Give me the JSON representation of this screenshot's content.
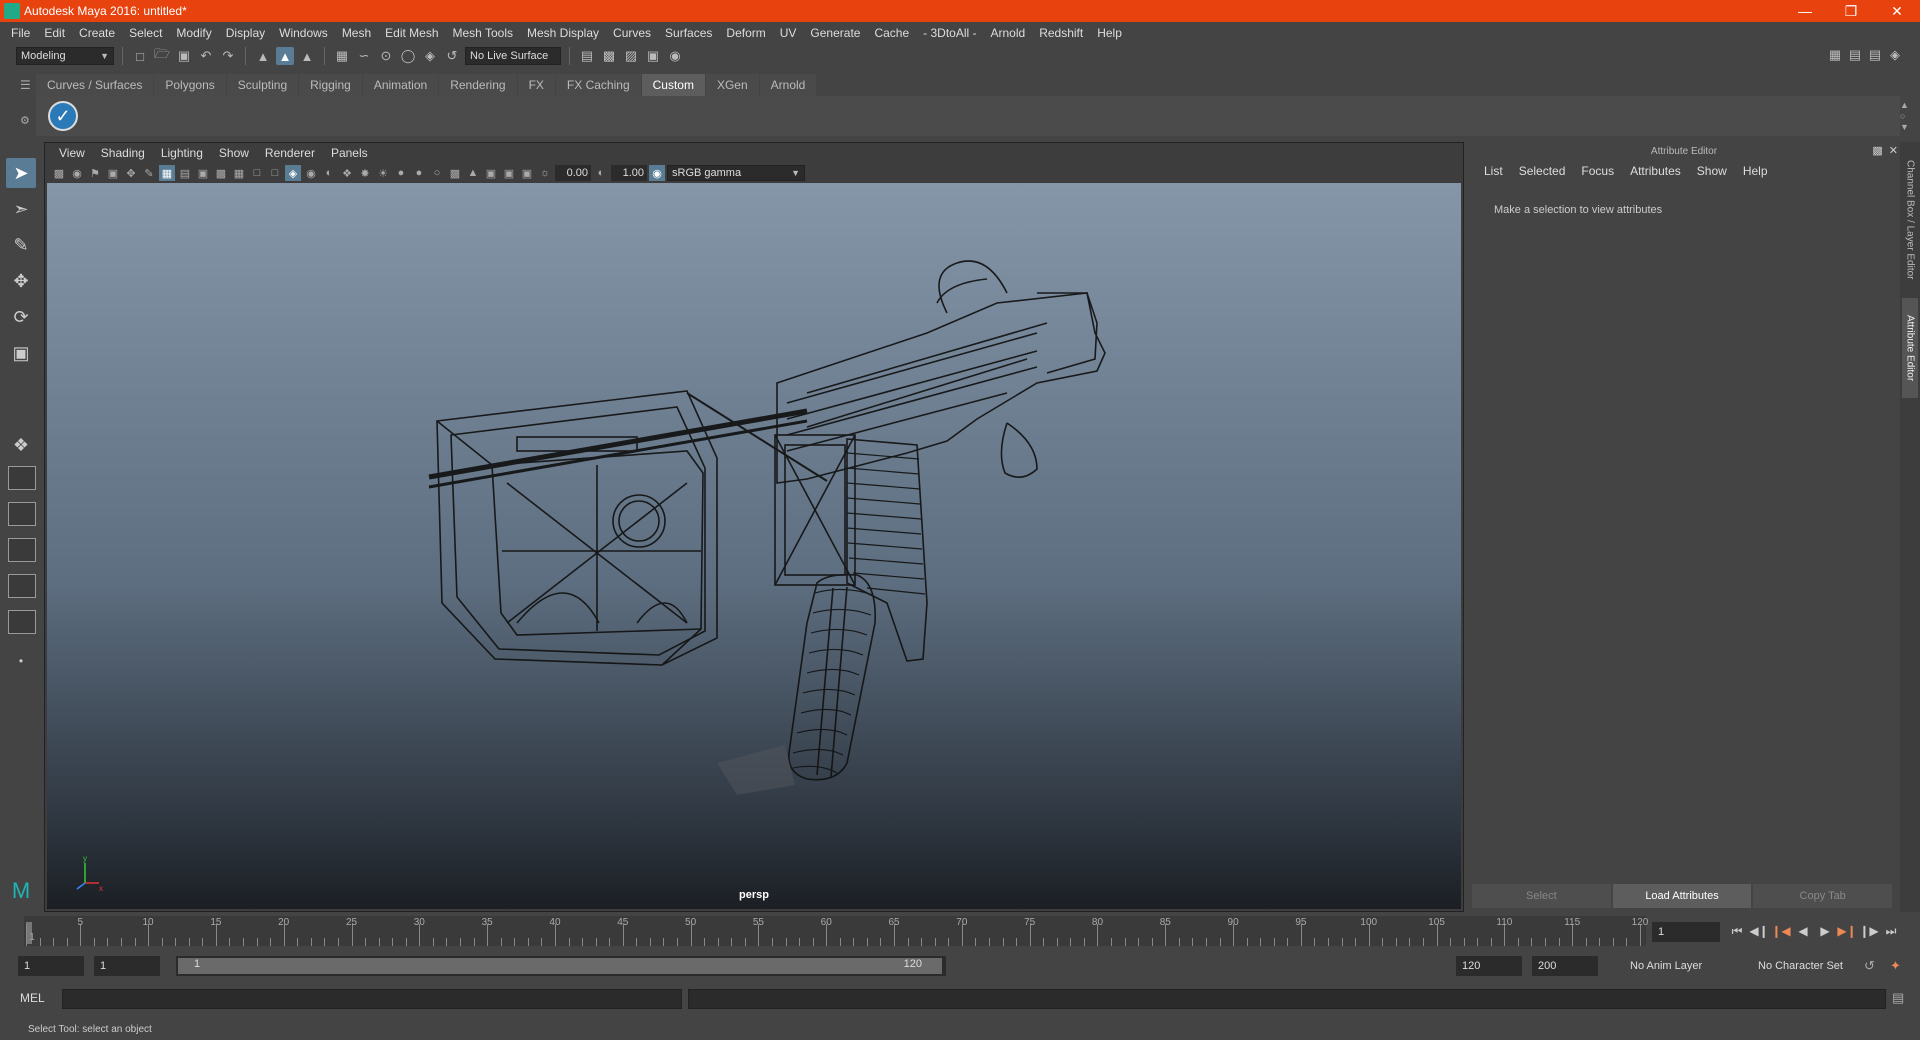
{
  "window": {
    "title": "Autodesk Maya 2016: untitled*"
  },
  "menubar": [
    "File",
    "Edit",
    "Create",
    "Select",
    "Modify",
    "Display",
    "Windows",
    "Mesh",
    "Edit Mesh",
    "Mesh Tools",
    "Mesh Display",
    "Curves",
    "Surfaces",
    "Deform",
    "UV",
    "Generate",
    "Cache",
    "- 3DtoAll -",
    "Arnold",
    "Redshift",
    "Help"
  ],
  "statusline": {
    "menuset": "Modeling",
    "live_surface": "No Live Surface"
  },
  "shelf": {
    "tabs": [
      "Curves / Surfaces",
      "Polygons",
      "Sculpting",
      "Rigging",
      "Animation",
      "Rendering",
      "FX",
      "FX Caching",
      "Custom",
      "XGen",
      "Arnold"
    ],
    "active_tab": "Custom"
  },
  "viewport": {
    "menus": [
      "View",
      "Shading",
      "Lighting",
      "Show",
      "Renderer",
      "Panels"
    ],
    "exposure": "0.00",
    "gamma": "1.00",
    "colorspace": "sRGB gamma",
    "camera": "persp",
    "axis_y": "y",
    "axis_x": "x"
  },
  "attribute_editor": {
    "title": "Attribute Editor",
    "menus": [
      "List",
      "Selected",
      "Focus",
      "Attributes",
      "Show",
      "Help"
    ],
    "message": "Make a selection to view attributes",
    "buttons": {
      "select": "Select",
      "load": "Load Attributes",
      "copy": "Copy Tab"
    }
  },
  "side_tabs": {
    "channel_box": "Channel Box / Layer Editor",
    "attribute_editor": "Attribute Editor"
  },
  "timeline": {
    "ticks": [
      "1",
      "5",
      "10",
      "15",
      "20",
      "25",
      "30",
      "35",
      "40",
      "45",
      "50",
      "55",
      "60",
      "65",
      "70",
      "75",
      "80",
      "85",
      "90",
      "95",
      "100",
      "105",
      "110",
      "115",
      "120"
    ],
    "current_frame": "1"
  },
  "range": {
    "start": "1",
    "playback_start": "1",
    "slider_start": "1",
    "slider_end": "120",
    "playback_end": "120",
    "end": "200",
    "anim_layer": "No Anim Layer",
    "character_set": "No Character Set"
  },
  "command_line": {
    "label": "MEL"
  },
  "help_line": {
    "text": "Select Tool: select an object"
  }
}
